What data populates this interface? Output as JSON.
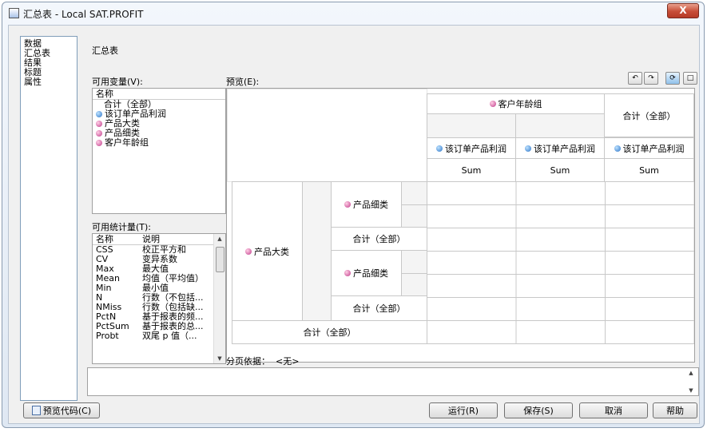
{
  "window": {
    "title": "汇总表 - Local SAT.PROFIT",
    "close_label": "X"
  },
  "nav": {
    "items": [
      "数据",
      "汇总表",
      "结果",
      "标题",
      "属性"
    ]
  },
  "page_heading": "汇总表",
  "variables": {
    "label": "可用变量(V):",
    "header": "名称",
    "items": [
      {
        "text": "合计（全部）",
        "icon": ""
      },
      {
        "text": "该订单产品利润",
        "icon": "measure-icon"
      },
      {
        "text": "产品大类",
        "icon": "category-icon"
      },
      {
        "text": "产品细类",
        "icon": "category-icon"
      },
      {
        "text": "客户年龄组",
        "icon": "category-icon"
      }
    ]
  },
  "statistics": {
    "label": "可用统计量(T):",
    "headers": [
      "名称",
      "说明"
    ],
    "rows": [
      [
        "CSS",
        "校正平方和"
      ],
      [
        "CV",
        "变异系数"
      ],
      [
        "Max",
        "最大值"
      ],
      [
        "Mean",
        "均值（平均值）"
      ],
      [
        "Min",
        "最小值"
      ],
      [
        "N",
        "行数（不包括..."
      ],
      [
        "NMiss",
        "行数（包括缺..."
      ],
      [
        "PctN",
        "基于报表的频..."
      ],
      [
        "PctSum",
        "基于报表的总..."
      ],
      [
        "Probt",
        "双尾 p 值（..."
      ]
    ]
  },
  "preview": {
    "label": "预览(E):",
    "col_group": "客户年龄组",
    "col_total": "合计（全部）",
    "measure": "该订单产品利润",
    "stat": "Sum",
    "row_group": "产品大类",
    "row_sub": "产品细类",
    "sub_total": "合计（全部）",
    "grand_total": "合计（全部）"
  },
  "paging": {
    "label": "分页依据：",
    "value": "<无>"
  },
  "buttons": {
    "preview_code": "预览代码(C)",
    "run": "运行(R)",
    "save": "保存(S)",
    "cancel": "取消",
    "help": "帮助"
  },
  "toolbar": {
    "icons": [
      "undo-icon",
      "redo-icon",
      "refresh-icon",
      "maximize-icon"
    ]
  },
  "colors": {
    "close_button": "#c74d36",
    "measure_icon": "#2b74c8",
    "category_icon": "#c03a8a"
  }
}
